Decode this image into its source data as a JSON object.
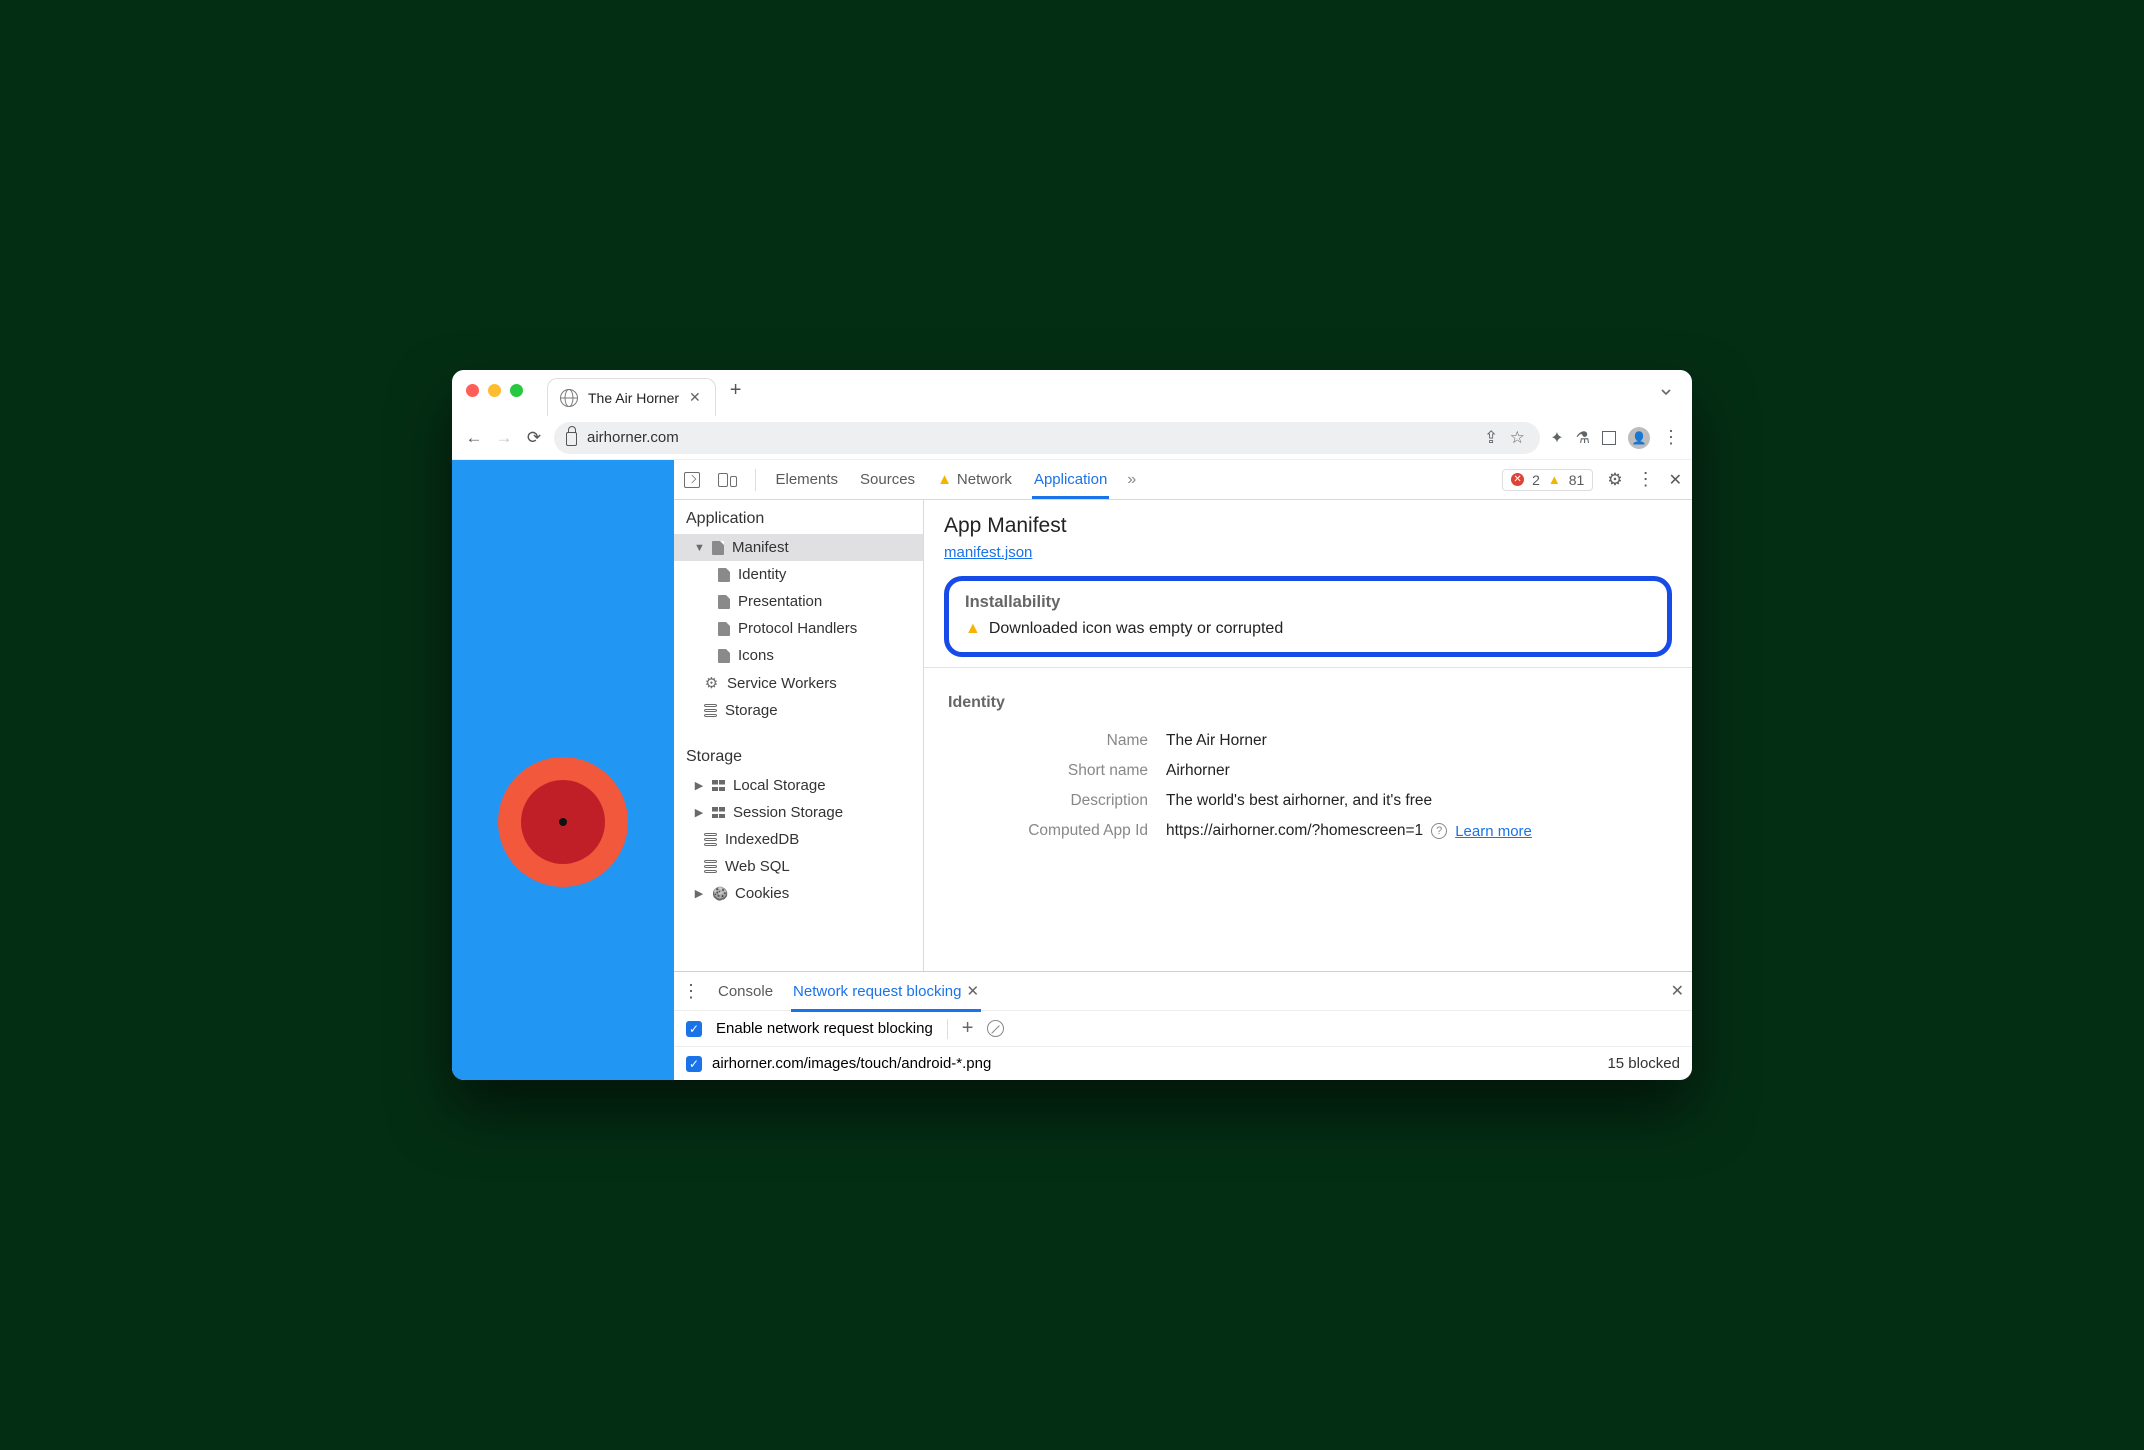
{
  "window": {
    "tab_title": "The Air Horner",
    "omnibox": "airhorner.com"
  },
  "devtabs": {
    "elements": "Elements",
    "sources": "Sources",
    "network": "Network",
    "application": "Application",
    "errors": "2",
    "warnings": "81"
  },
  "sidebar": {
    "app_heading": "Application",
    "manifest": "Manifest",
    "identity": "Identity",
    "presentation": "Presentation",
    "protocol": "Protocol Handlers",
    "icons": "Icons",
    "sw": "Service Workers",
    "storage": "Storage",
    "storage_heading": "Storage",
    "local": "Local Storage",
    "session": "Session Storage",
    "idb": "IndexedDB",
    "websql": "Web SQL",
    "cookies": "Cookies"
  },
  "manifest": {
    "heading": "App Manifest",
    "link": "manifest.json",
    "install_head": "Installability",
    "install_msg": "Downloaded icon was empty or corrupted",
    "identity_head": "Identity",
    "name_label": "Name",
    "name": "The Air Horner",
    "short_label": "Short name",
    "short": "Airhorner",
    "desc_label": "Description",
    "desc": "The world's best airhorner, and it's free",
    "appid_label": "Computed App Id",
    "appid": "https://airhorner.com/?homescreen=1",
    "learn": "Learn more"
  },
  "drawer": {
    "console": "Console",
    "nrb": "Network request blocking",
    "enable": "Enable network request blocking",
    "pattern": "airhorner.com/images/touch/android-*.png",
    "blocked": "15 blocked"
  }
}
